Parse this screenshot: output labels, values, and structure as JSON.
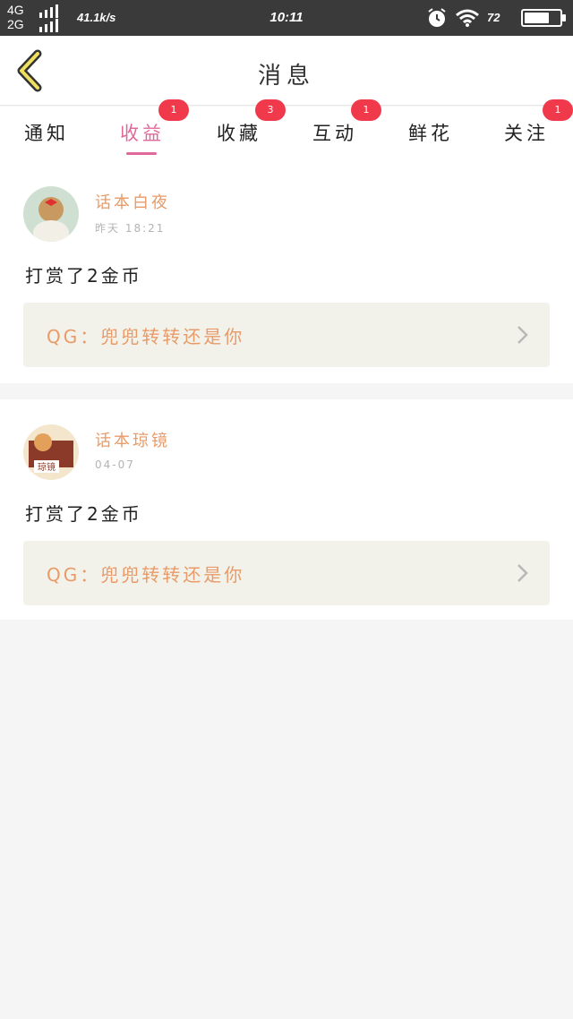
{
  "status_bar": {
    "network_top": "4G",
    "network_bottom": "2G",
    "speed": "41.1k/s",
    "time": "10:11",
    "battery_text": "72",
    "battery_level": 0.72
  },
  "header": {
    "title": "消息",
    "back_icon": "chevron-left-icon"
  },
  "tabs": [
    {
      "label": "通知",
      "badge": "",
      "active": false
    },
    {
      "label": "收益",
      "badge": "1",
      "active": true
    },
    {
      "label": "收藏",
      "badge": "3",
      "active": false
    },
    {
      "label": "互动",
      "badge": "1",
      "active": false
    },
    {
      "label": "鲜花",
      "badge": "",
      "active": false
    },
    {
      "label": "关注",
      "badge": "1",
      "active": false
    }
  ],
  "messages": [
    {
      "user": "话本白夜",
      "time": "昨天 18:21",
      "action": "打赏了2金币",
      "quote": "QG：兜兜转转还是你"
    },
    {
      "user": "话本琼镜",
      "time": "04-07",
      "action": "打赏了2金币",
      "quote": "QG：兜兜转转还是你"
    }
  ],
  "colors": {
    "accent": "#e0689a",
    "name": "#e89b68",
    "badge": "#f03a4c",
    "quote_bg": "#f3f2ea"
  }
}
